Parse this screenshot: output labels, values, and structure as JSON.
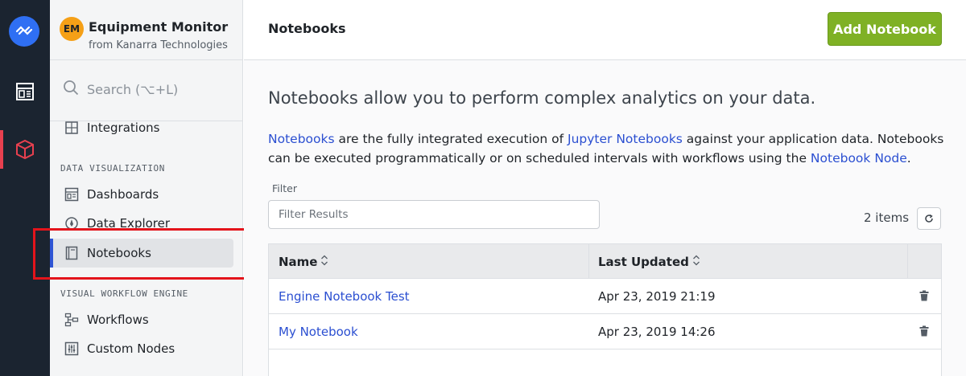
{
  "rail": {
    "items": [
      "logo-icon",
      "dashboard-icon",
      "cube-icon"
    ],
    "active_color": "#e8404f"
  },
  "app": {
    "initials": "EM",
    "name": "Equipment Monitor",
    "org": "from Kanarra Technologies",
    "avatar_color": "#f5a017"
  },
  "search": {
    "placeholder": "Search (⌥+L)"
  },
  "sidebar": {
    "items_top": [
      {
        "label": "Integrations",
        "icon": "puzzle-icon"
      }
    ],
    "sections": [
      {
        "title": "DATA VISUALIZATION",
        "items": [
          {
            "label": "Dashboards",
            "icon": "dashboard-icon"
          },
          {
            "label": "Data Explorer",
            "icon": "compass-icon"
          },
          {
            "label": "Notebooks",
            "icon": "book-icon",
            "active": true
          }
        ]
      },
      {
        "title": "VISUAL WORKFLOW ENGINE",
        "items": [
          {
            "label": "Workflows",
            "icon": "workflow-icon"
          },
          {
            "label": "Custom Nodes",
            "icon": "sliders-icon"
          }
        ]
      }
    ]
  },
  "header": {
    "title": "Notebooks",
    "add_label": "Add Notebook",
    "accent": "#7fb125"
  },
  "intro": {
    "lead": "Notebooks allow you to perform complex analytics on your data.",
    "link1": "Notebooks",
    "text1": " are the fully integrated execution of ",
    "link2": "Jupyter Notebooks",
    "text2": " against your application data. Notebooks can be executed programmatically or on scheduled intervals with workflows using the ",
    "link3": "Notebook Node",
    "text3": "."
  },
  "filter": {
    "label": "Filter",
    "placeholder": "Filter Results",
    "value": ""
  },
  "count": "2 items",
  "table": {
    "columns": [
      "Name",
      "Last Updated"
    ],
    "rows": [
      {
        "name": "Engine Notebook Test",
        "updated": "Apr 23, 2019 21:19"
      },
      {
        "name": "My Notebook",
        "updated": "Apr 23, 2019 14:26"
      }
    ]
  },
  "colors": {
    "link": "#2b4fd1",
    "rail_bg": "#1b2430",
    "highlight": "#e3141b"
  }
}
